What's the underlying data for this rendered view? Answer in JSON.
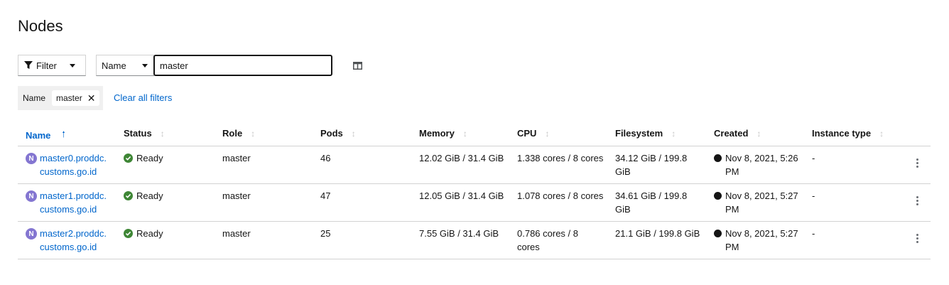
{
  "page": {
    "title": "Nodes"
  },
  "toolbar": {
    "filter_label": "Filter",
    "attribute_select": "Name",
    "search_value": "master"
  },
  "chips": {
    "category": "Name",
    "value": "master",
    "clear_all": "Clear all filters"
  },
  "table": {
    "columns": [
      "Name",
      "Status",
      "Role",
      "Pods",
      "Memory",
      "CPU",
      "Filesystem",
      "Created",
      "Instance type"
    ],
    "sort_ascending_icon": "arrow-up-icon",
    "sortable_icon": "sort-icon",
    "rows": [
      {
        "badge": "N",
        "name": "master0.proddc.customs.go.id",
        "status": "Ready",
        "role": "master",
        "pods": "46",
        "memory": "12.02 GiB / 31.4 GiB",
        "cpu": "1.338 cores / 8 cores",
        "filesystem": "34.12 GiB / 199.8 GiB",
        "created": "Nov 8, 2021, 5:26 PM",
        "instance_type": "-"
      },
      {
        "badge": "N",
        "name": "master1.proddc.customs.go.id",
        "status": "Ready",
        "role": "master",
        "pods": "47",
        "memory": "12.05 GiB / 31.4 GiB",
        "cpu": "1.078 cores / 8 cores",
        "filesystem": "34.61 GiB / 199.8 GiB",
        "created": "Nov 8, 2021, 5:27 PM",
        "instance_type": "-"
      },
      {
        "badge": "N",
        "name": "master2.proddc.customs.go.id",
        "status": "Ready",
        "role": "master",
        "pods": "25",
        "memory": "7.55 GiB / 31.4 GiB",
        "cpu": "0.786 cores / 8 cores",
        "filesystem": "21.1 GiB / 199.8 GiB",
        "created": "Nov 8, 2021, 5:27 PM",
        "instance_type": "-"
      }
    ]
  },
  "colors": {
    "link": "#0066cc",
    "node_badge": "#8476d1",
    "ready": "#3e8635",
    "border": "#d2d2d2"
  }
}
